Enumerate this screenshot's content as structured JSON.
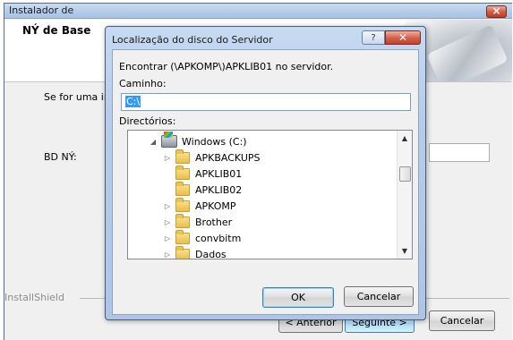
{
  "installer": {
    "title": "Instalador de",
    "heading": "NÝ de Base",
    "body_text": "Se for uma ir",
    "bd_label": "BD NÝ:",
    "brand": "InstallShield",
    "back_label": "< Anterior",
    "next_label": "Seguinte >",
    "cancel_label": "Cancelar"
  },
  "dialog": {
    "title": "Localização do disco do Servidor",
    "help_label": "?",
    "close_label": "✕",
    "find_text": "Encontrar (\\APKOMP\\)APKLIB01 no servidor.",
    "path_label": "Caminho:",
    "path_value": "C:\\",
    "dirs_label": "Directórios:",
    "tree": [
      {
        "label": "Windows (C:)",
        "expander": "◢",
        "icon": "drive-icon"
      },
      {
        "label": "APKBACKUPS",
        "expander": "▷",
        "icon": "folder-icon"
      },
      {
        "label": "APKLIB01",
        "expander": "",
        "icon": "folder-icon"
      },
      {
        "label": "APKLIB02",
        "expander": "",
        "icon": "folder-icon"
      },
      {
        "label": "APKOMP",
        "expander": "▷",
        "icon": "folder-icon"
      },
      {
        "label": "Brother",
        "expander": "▷",
        "icon": "folder-icon"
      },
      {
        "label": "convbitm",
        "expander": "▷",
        "icon": "folder-icon"
      },
      {
        "label": "Dados",
        "expander": "▷",
        "icon": "folder-icon"
      }
    ],
    "scroll_up": "▲",
    "scroll_down": "▼",
    "ok_label": "OK",
    "cancel_label": "Cancelar"
  }
}
